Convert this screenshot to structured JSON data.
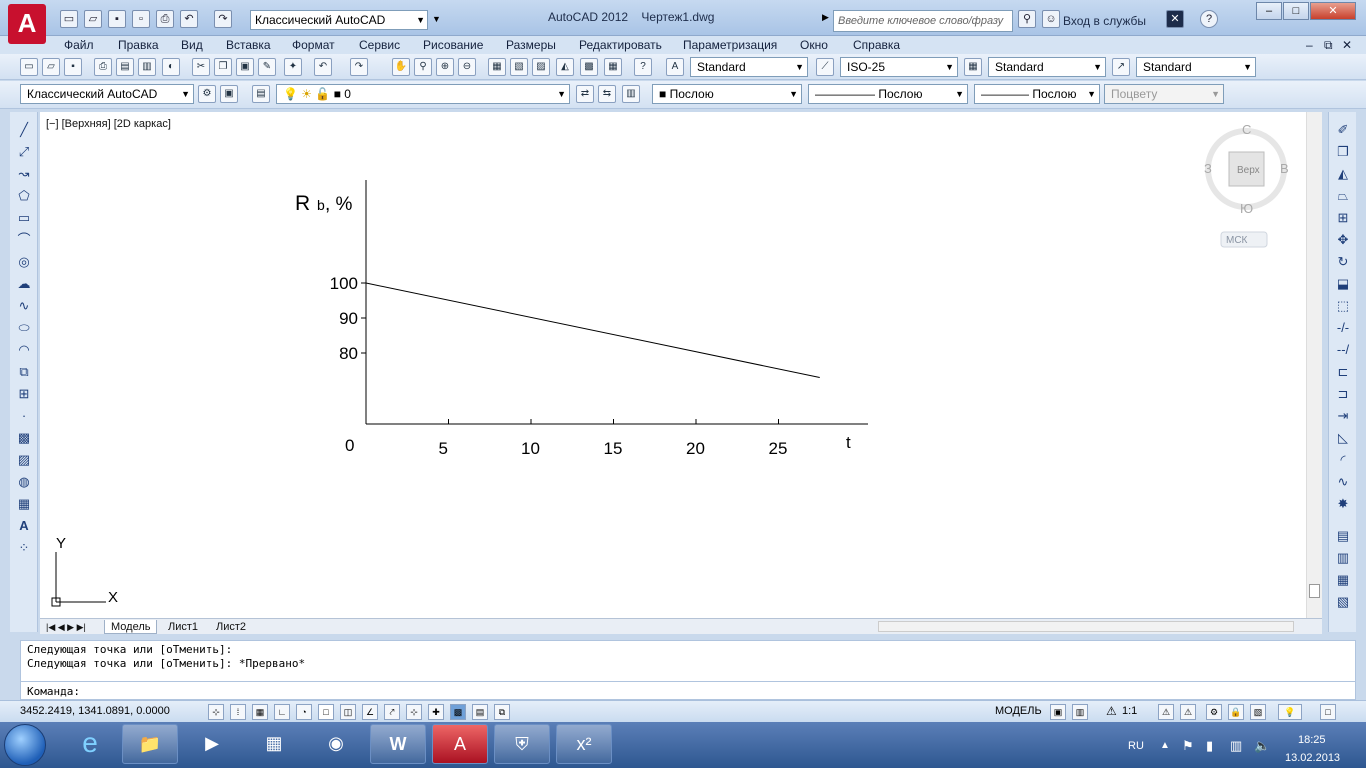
{
  "title_bar": {
    "workspace": "Классический AutoCAD",
    "app_name": "AutoCAD 2012",
    "file_name": "Чертеж1.dwg",
    "search_placeholder": "Введите ключевое слово/фразу",
    "login": "Вход в службы"
  },
  "menu": [
    "Файл",
    "Правка",
    "Вид",
    "Вставка",
    "Формат",
    "Сервис",
    "Рисование",
    "Размеры",
    "Редактировать",
    "Параметризация",
    "Окно",
    "Справка"
  ],
  "styles": {
    "text_style": "Standard",
    "dim_style": "ISO-25",
    "table_style": "Standard",
    "mleader_style": "Standard"
  },
  "layers": {
    "workspace": "Классический AutoCAD",
    "layer": "0",
    "color": "Послою",
    "linetype": "Послою",
    "lineweight": "Послою",
    "plot_style": "Поцвету"
  },
  "viewport": {
    "label": "[−] [Верхняя] [2D каркас]",
    "viewcube": {
      "n": "С",
      "s": "Ю",
      "w": "З",
      "e": "В",
      "face": "Верх"
    },
    "ucs_menu": "МСК",
    "ucs_x": "X",
    "ucs_y": "Y"
  },
  "drawing": {
    "y_label_main": "R",
    "y_label_sub": "b",
    "y_label_tail": ", %",
    "origin_label": "0",
    "x_axis_label": "t",
    "y_ticks": [
      {
        "value": 100,
        "label": "100"
      },
      {
        "value": 90,
        "label": "90"
      },
      {
        "value": 80,
        "label": "80"
      }
    ],
    "x_ticks": [
      {
        "value": 5,
        "label": "5"
      },
      {
        "value": 10,
        "label": "10"
      },
      {
        "value": 15,
        "label": "15"
      },
      {
        "value": 20,
        "label": "20"
      },
      {
        "value": 25,
        "label": "25"
      }
    ],
    "line": {
      "x_start": 0,
      "y_start": 100,
      "x_end": 27.5,
      "y_end": 73
    }
  },
  "layout_tabs": [
    "Модель",
    "Лист1",
    "Лист2"
  ],
  "command": {
    "line1": "Следующая точка или [оТменить]:",
    "line2": "Следующая точка или [оТменить]: *Прервано*",
    "prompt": "Команда:"
  },
  "status": {
    "coords": "3452.2419, 1341.0891, 0.0000",
    "model": "МОДЕЛЬ",
    "scale": "1:1"
  },
  "taskbar": {
    "lang": "RU",
    "time": "18:25",
    "date": "13.02.2013"
  }
}
